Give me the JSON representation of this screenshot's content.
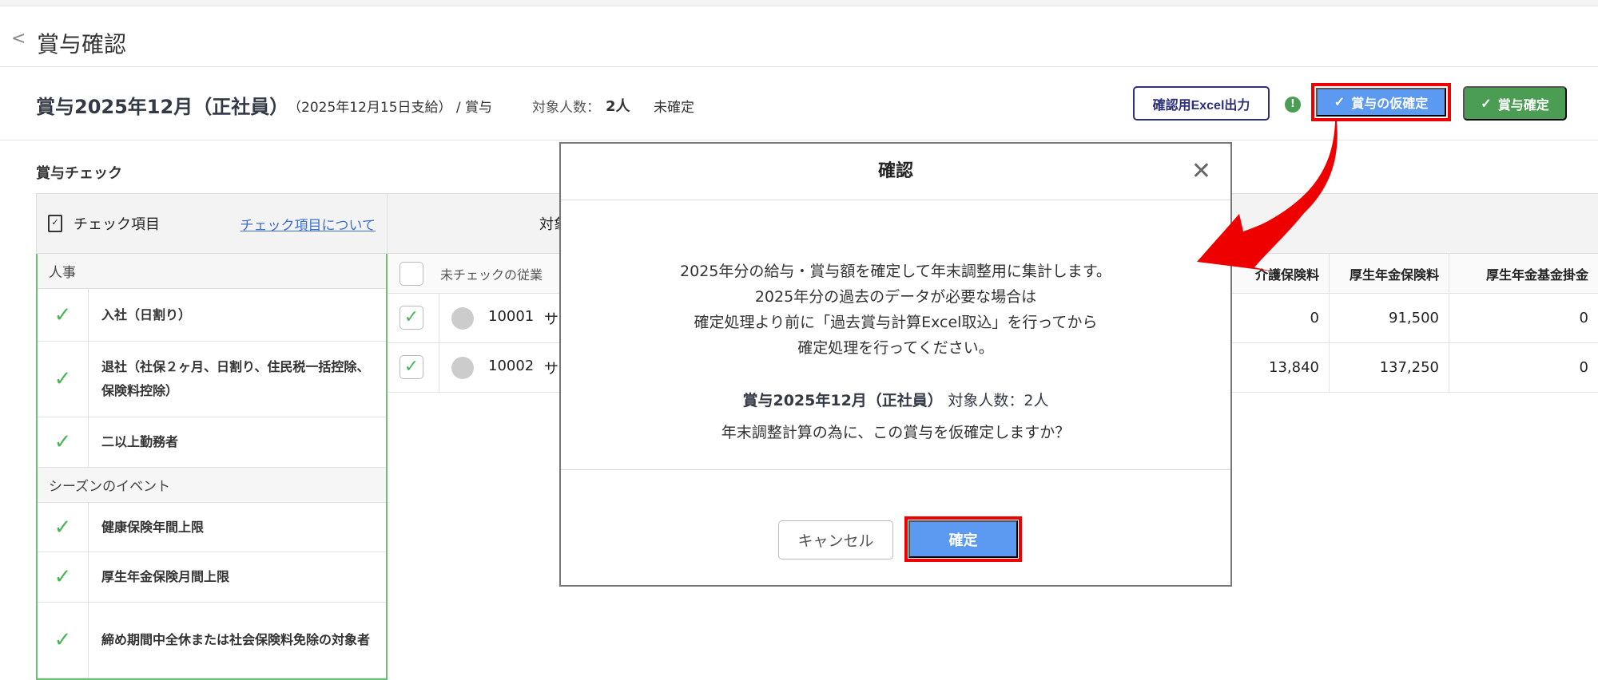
{
  "header": {
    "back_icon": "chevron-left-icon",
    "title": "賞与確認"
  },
  "summary": {
    "bonus_title": "賞与2025年12月（正社員）",
    "pay_date": "（2025年12月15日支給） / 賞与",
    "count_label": "対象人数：",
    "count_value": "2人",
    "status": "未確定"
  },
  "toolbar": {
    "excel_label": "確認用Excel出力",
    "warning_icon": "!",
    "provisional_label": "賞与の仮確定",
    "finalize_label": "賞与確定",
    "highlight_color": "#ee0000",
    "provisional_color": "#5b9af0",
    "finalize_color": "#4a9d52"
  },
  "check_section": {
    "title": "賞与チェック",
    "header_label": "チェック項目",
    "about_link": "チェック項目について",
    "groups": [
      {
        "name": "人事",
        "items": [
          "入社（日割り）",
          "退社（社保２ヶ月、日割り、住民税一括控除、保険料控除）",
          "二以上勤務者"
        ]
      },
      {
        "name": "シーズンのイベント",
        "items": [
          "健康保険年間上限",
          "厚生年金保険月間上限",
          "締め期間中全休または社会保険料免除の対象者"
        ]
      }
    ]
  },
  "table": {
    "top_header": "対象",
    "unchecked_label": "未チェックの従業",
    "columns": [
      "介護保険料",
      "厚生年金保険料",
      "厚生年金基金掛金"
    ],
    "rows": [
      {
        "id": "10001",
        "name": "サ",
        "values": [
          "0",
          "91,500",
          "0"
        ]
      },
      {
        "id": "10002",
        "name": "サ",
        "values": [
          "13,840",
          "137,250",
          "0"
        ]
      }
    ]
  },
  "modal": {
    "title": "確認",
    "lines": [
      "2025年分の給与・賞与額を確定して年末調整用に集計します。",
      "2025年分の過去のデータが必要な場合は",
      "確定処理より前に「過去賞与計算Excel取込」を行ってから",
      "確定処理を行ってください。"
    ],
    "target": "賞与2025年12月（正社員）",
    "target_count": "対象人数：2人",
    "question": "年末調整計算の為に、この賞与を仮確定しますか？",
    "cancel_label": "キャンセル",
    "confirm_label": "確定"
  }
}
